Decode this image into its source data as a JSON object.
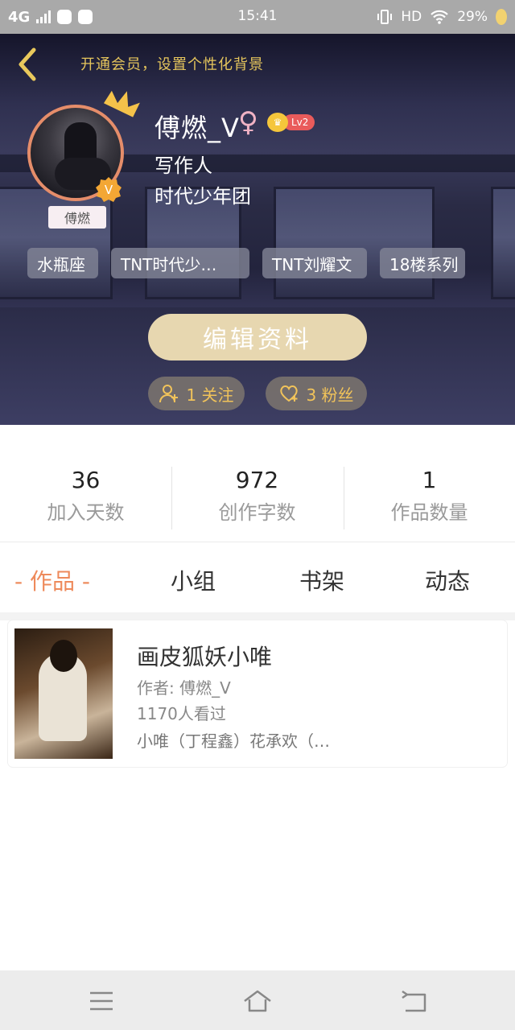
{
  "status_bar": {
    "network": "4G",
    "time": "15:41",
    "hd": "HD",
    "battery": "29%"
  },
  "header": {
    "promo_text": "开通会员，设置个性化背景",
    "profile": {
      "name": "傅燃_V",
      "gender_symbol": "♀",
      "level": "Lv2",
      "role": "写作人",
      "group": "时代少年团",
      "name_tag": "傅燃"
    },
    "tags": [
      "水瓶座",
      "TNT时代少…",
      "TNT刘耀文",
      "18楼系列"
    ],
    "edit_button": "编辑资料",
    "following": "1 关注",
    "followers": "3 粉丝"
  },
  "stats": [
    {
      "value": "36",
      "label": "加入天数"
    },
    {
      "value": "972",
      "label": "创作字数"
    },
    {
      "value": "1",
      "label": "作品数量"
    }
  ],
  "tabs": {
    "works": "- 作品 -",
    "groups": "小组",
    "bookshelf": "书架",
    "updates": "动态"
  },
  "work": {
    "title": "画皮狐妖小唯",
    "author": "作者: 傅燃_V",
    "views": "1170人看过",
    "description": "小唯（丁程鑫）花承欢（…"
  },
  "colors": {
    "accent": "#ee8a5b",
    "gold": "#e5c55c",
    "edit_button": "#e7d7b0"
  }
}
